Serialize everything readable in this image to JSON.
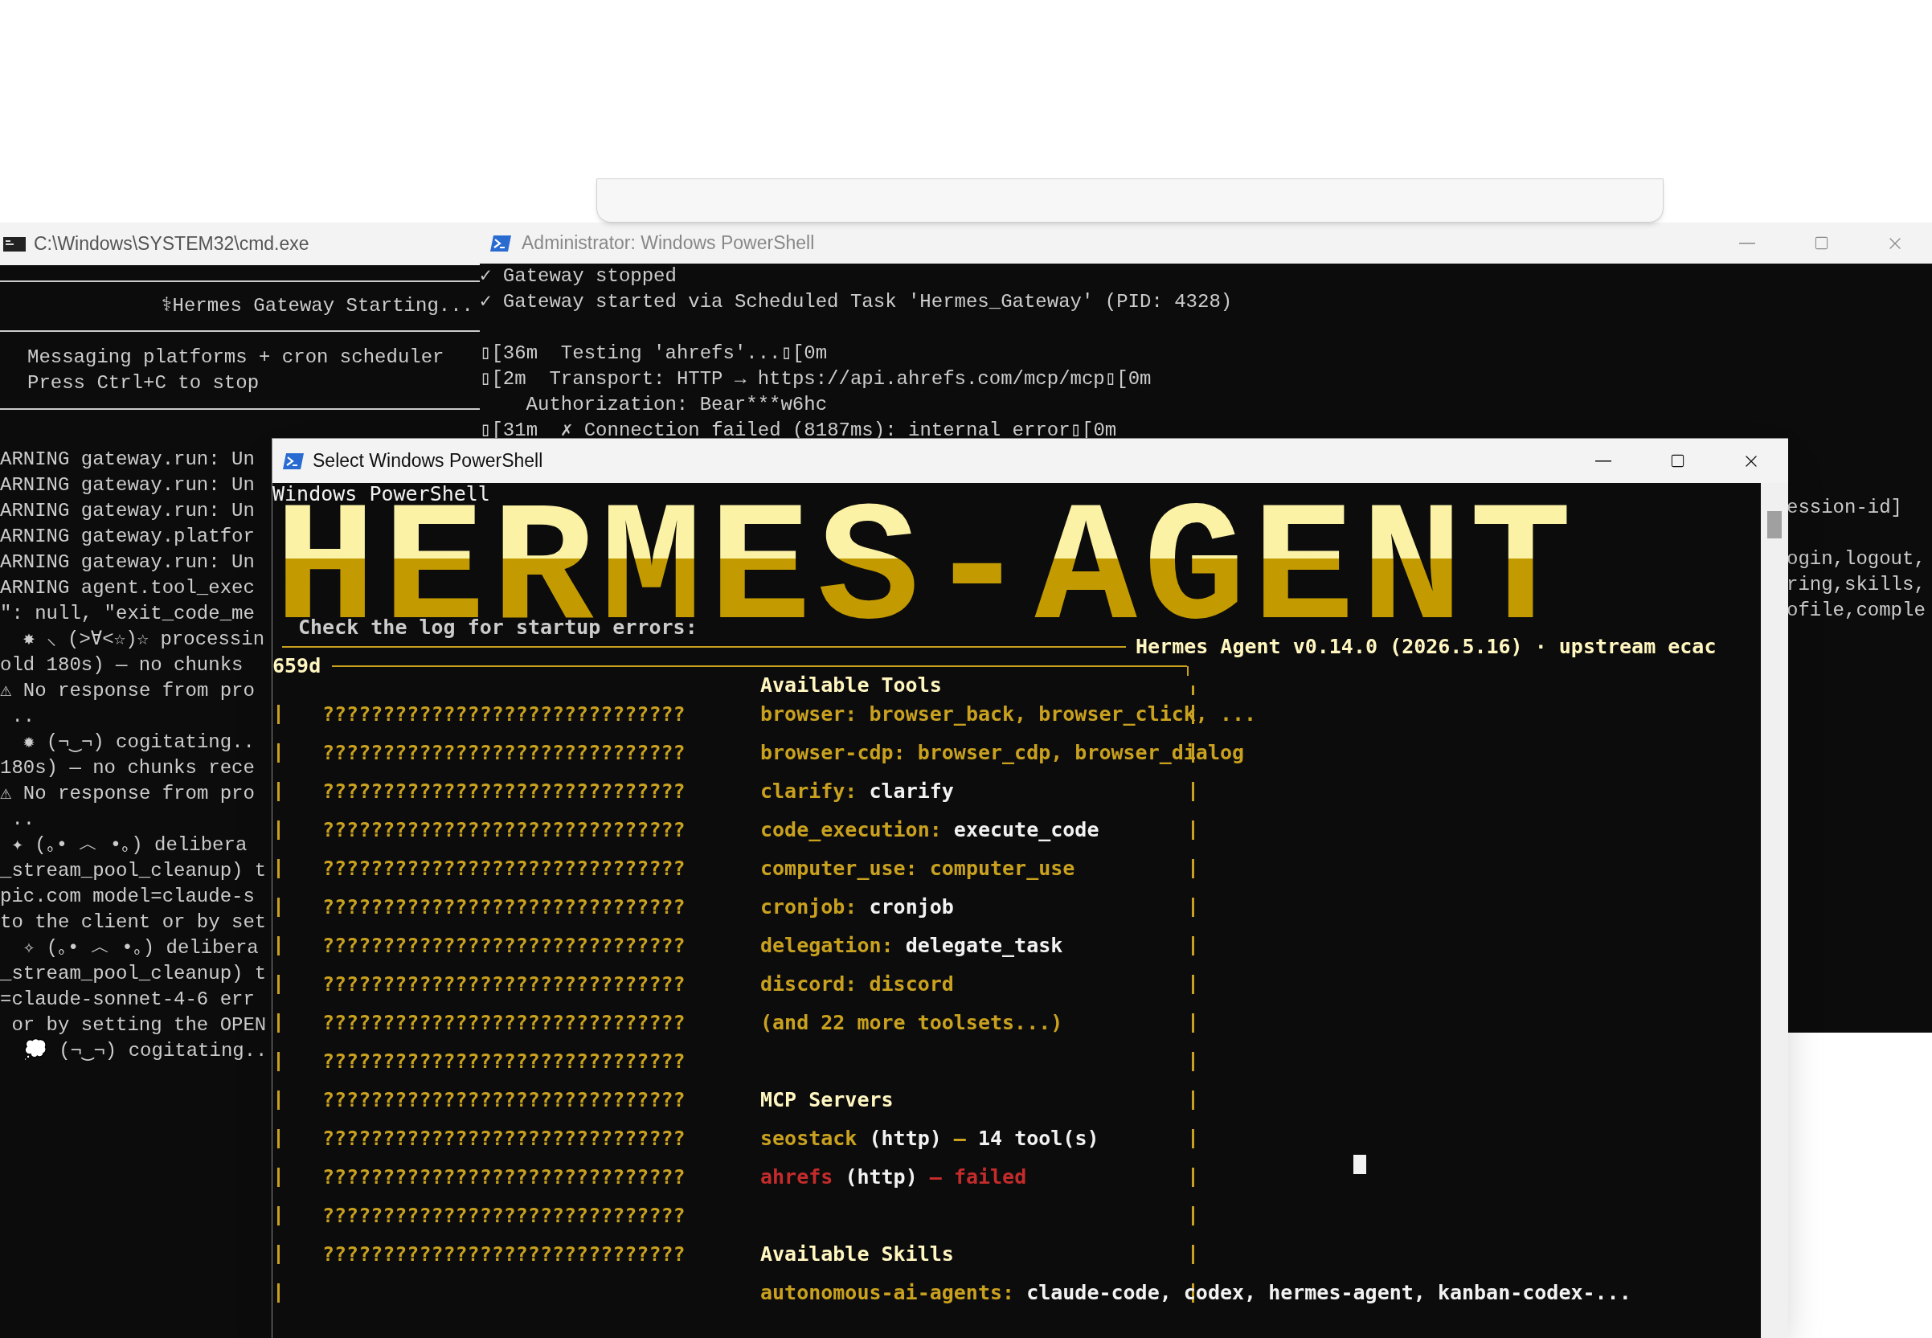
{
  "cmd_window": {
    "title": "C:\\Windows\\SYSTEM32\\cmd.exe",
    "banner": "⚕Hermes Gateway Starting...",
    "info_lines": [
      "Messaging platforms + cron scheduler",
      "Press Ctrl+C to stop"
    ],
    "log_lines": [
      "ARNING gateway.run: Un",
      "ARNING gateway.run: Un",
      "ARNING gateway.run: Un",
      "ARNING gateway.platfor",
      "ARNING gateway.run: Un",
      "ARNING agent.tool_exec",
      "\": null, \"exit_code_me",
      "  ✸ ⸜ (>∀<☆)☆ processin",
      "old 180s) — no chunks",
      "⚠ No response from pro",
      " ..",
      "  ✹ (¬‿¬) cogitating..",
      "180s) — no chunks rece",
      "⚠ No response from pro",
      " ..",
      " ✦ (｡• ︿ •｡) delibera",
      "_stream_pool_cleanup) t",
      "pic.com model=claude-s",
      "to the client or by set",
      "  ✧ (｡• ︿ •｡) delibera",
      "_stream_pool_cleanup) t",
      "=claude-sonnet-4-6 err",
      " or by setting the OPEN",
      "  💭 (¬‿¬) cogitating.."
    ]
  },
  "admin_window": {
    "title": "Administrator: Windows PowerShell",
    "blocks": [
      [
        "✓ Gateway stopped",
        "✓ Gateway started via Scheduled Task 'Hermes_Gateway' (PID: 4328)"
      ],
      [
        "▯[36m  Testing 'ahrefs'...▯[0m",
        "▯[2m  Transport: HTTP → https://api.ahrefs.com/mcp/mcp▯[0m",
        "    Authorization: Bear***w6hc",
        "▯[31m  ✗ Connection failed (8187ms): internal error▯[0m"
      ]
    ],
    "side_blocks": [
      [
        "ession-id]"
      ],
      [
        "ogin,logout,",
        "ring,skills,",
        "ofile,comple"
      ]
    ]
  },
  "front_window": {
    "title": "Select Windows PowerShell",
    "first_line": "Windows PowerShell",
    "logo": "HERMES-AGENT",
    "notice": "Check the log for startup errors:",
    "version": "Hermes Agent v0.14.0 (2026.5.16) · upstream ecac",
    "box_label": "659d",
    "placeholder_rows": [
      "??????????????????????????????",
      "??????????????????????????????",
      "??????????????????????????????",
      "??????????????????????????????",
      "??????????????????????????????",
      "??????????????????????????????",
      "??????????????????????????????",
      "??????????????????????????????",
      "??????????????????????????????",
      "??????????????????????????????",
      "??????????????????????????????",
      "??????????????????????????????",
      "??????????????????????????????",
      "??????????????????????????????",
      "??????????????????????????????"
    ],
    "tools": {
      "title": "Available Tools",
      "items": [
        {
          "name": "browser:",
          "value": "browser_back, browser_click, ...",
          "color": "#c9a11f"
        },
        {
          "name": "browser-cdp:",
          "value": "browser_cdp, browser_dialog",
          "color": "#c9a11f"
        },
        {
          "name": "clarify:",
          "value": "clarify",
          "color": "#f2f2f2"
        },
        {
          "name": "code_execution:",
          "value": "execute_code",
          "color": "#f2f2f2"
        },
        {
          "name": "computer_use:",
          "value": "computer_use",
          "color": "#c9a11f"
        },
        {
          "name": "cronjob:",
          "value": "cronjob",
          "color": "#f2f2f2"
        },
        {
          "name": "delegation:",
          "value": "delegate_task",
          "color": "#f2f2f2"
        },
        {
          "name": "discord:",
          "value": "discord",
          "color": "#c9a11f"
        }
      ],
      "more": "(and 22 more toolsets...)"
    },
    "mcp": {
      "title": "MCP Servers",
      "servers": [
        {
          "name": "seostack",
          "transport": "(http)",
          "dash": "–",
          "status": "14 tool(s)",
          "failed": false
        },
        {
          "name": "ahrefs",
          "transport": "(http)",
          "dash": "–",
          "status": "failed",
          "failed": true
        }
      ]
    },
    "skills": {
      "title": "Available Skills",
      "items": [
        {
          "name": "autonomous-ai-agents:",
          "value": "claude-code, codex, hermes-agent, kanban-codex-..."
        }
      ]
    }
  }
}
